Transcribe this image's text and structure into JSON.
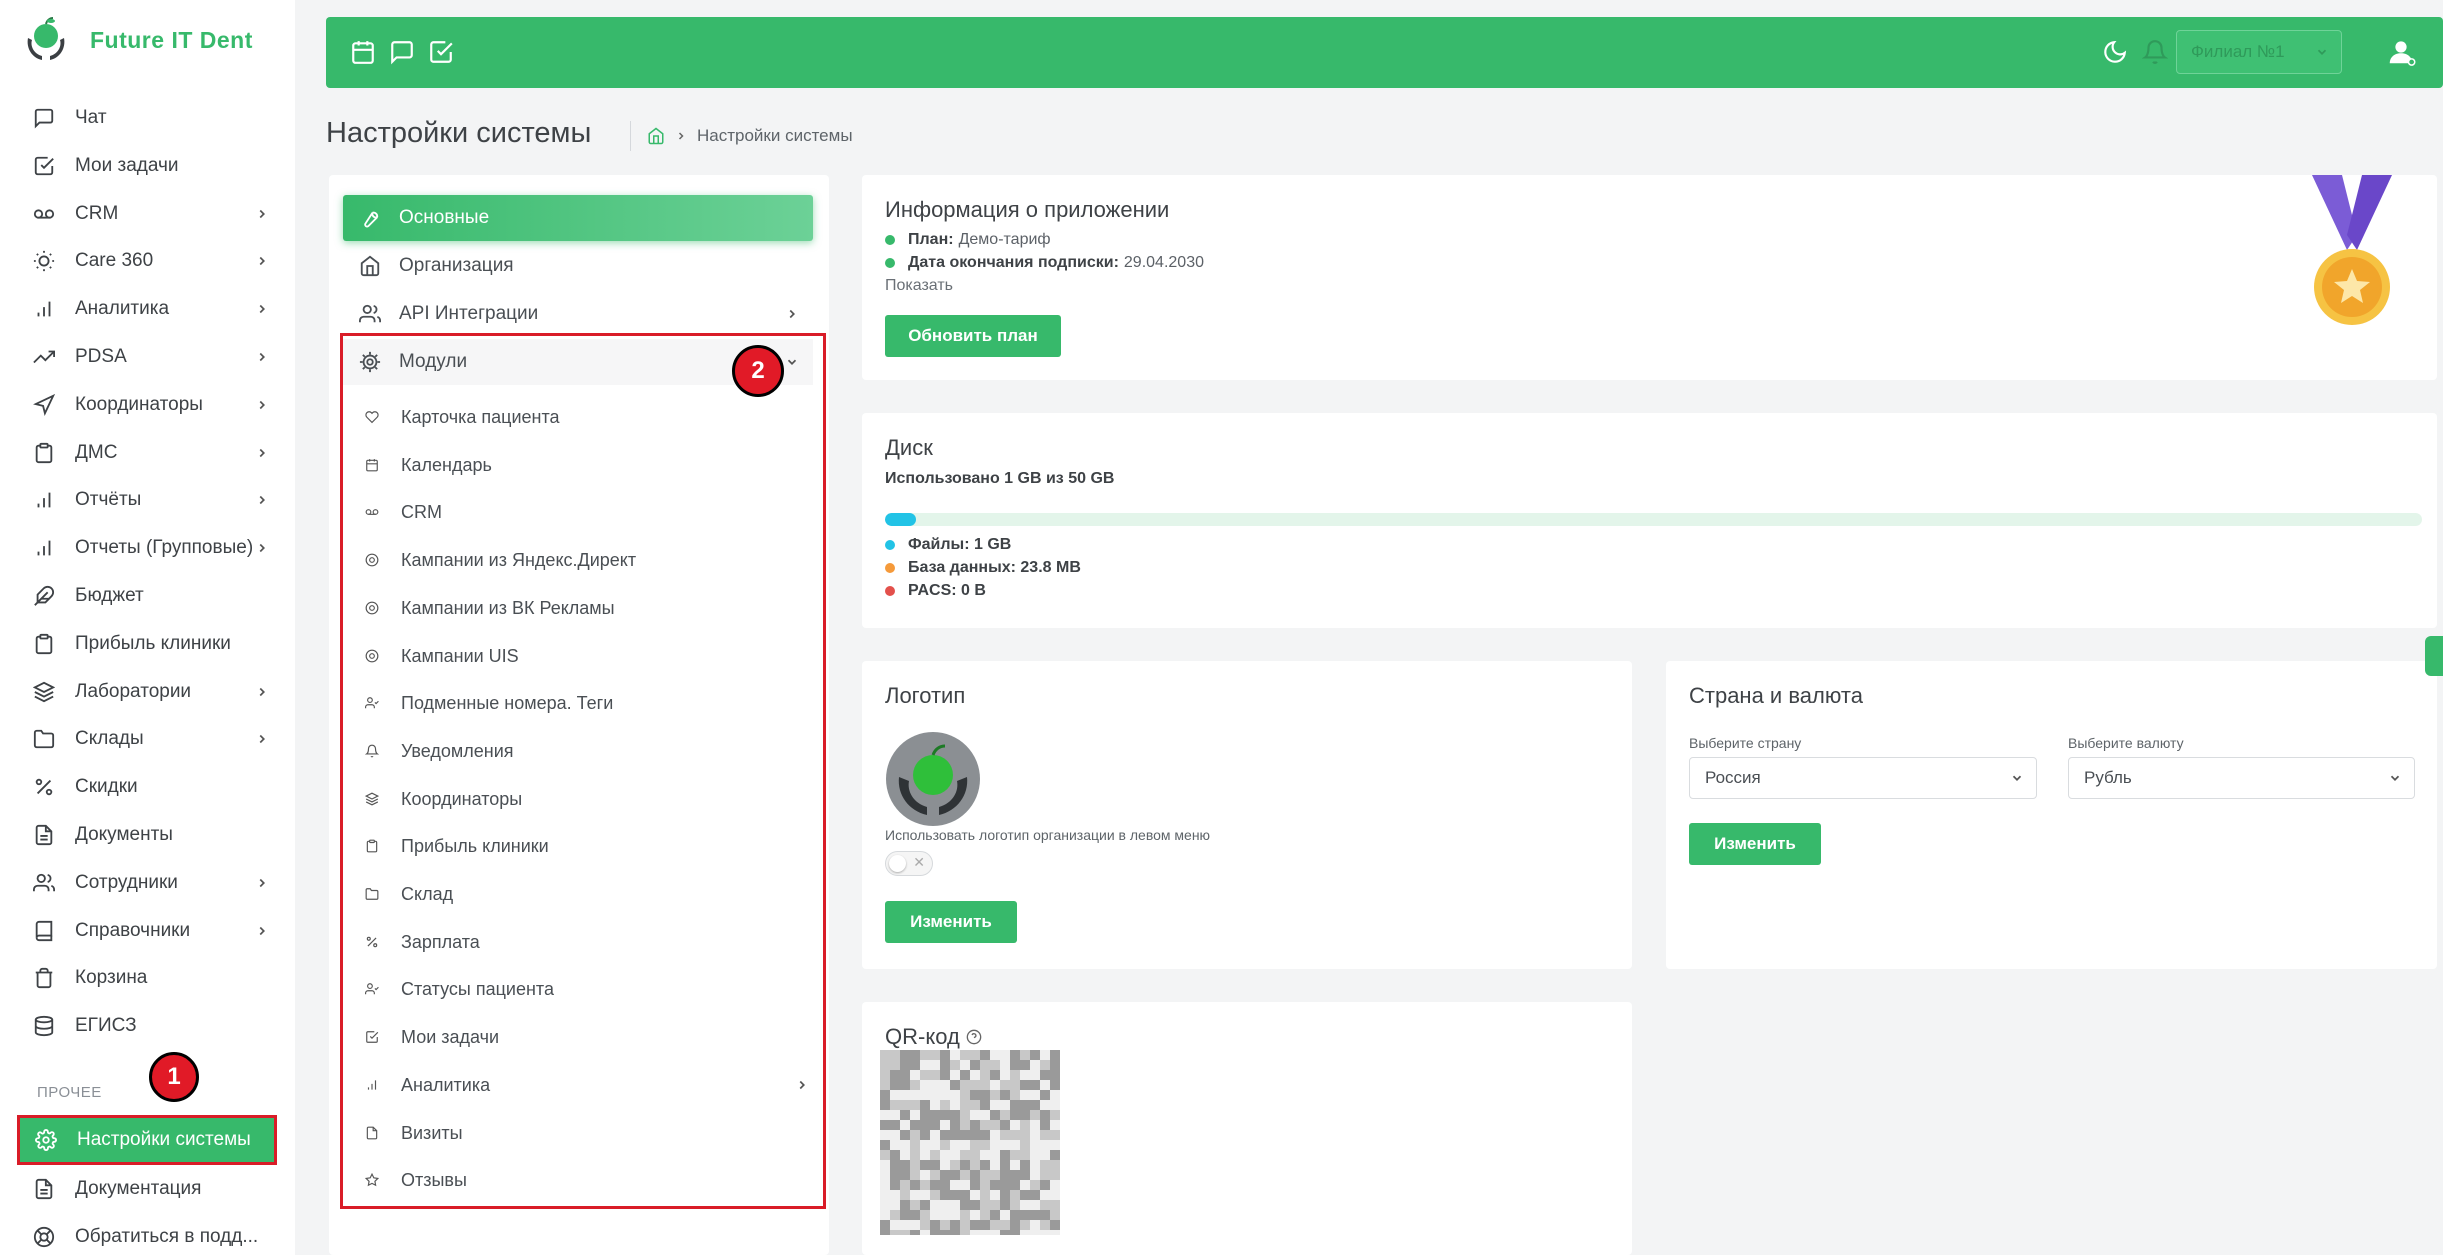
{
  "brand": {
    "name": "Future IT Dent"
  },
  "sidebar": {
    "items": [
      {
        "label": "Чат",
        "icon": "chat-icon",
        "arrow": false
      },
      {
        "label": "Мои задачи",
        "icon": "task-icon",
        "arrow": false
      },
      {
        "label": "CRM",
        "icon": "voicemail-icon",
        "arrow": true
      },
      {
        "label": "Care 360",
        "icon": "sun-icon",
        "arrow": true
      },
      {
        "label": "Аналитика",
        "icon": "bar-chart-icon",
        "arrow": true
      },
      {
        "label": "PDSA",
        "icon": "trending-icon",
        "arrow": true
      },
      {
        "label": "Координаторы",
        "icon": "navigation-icon",
        "arrow": true
      },
      {
        "label": "ДМС",
        "icon": "clipboard-icon",
        "arrow": true
      },
      {
        "label": "Отчёты",
        "icon": "bar-chart-icon",
        "arrow": true
      },
      {
        "label": "Отчеты (Групповые)",
        "icon": "bar-chart-icon",
        "arrow": true
      },
      {
        "label": "Бюджет",
        "icon": "feather-icon",
        "arrow": false
      },
      {
        "label": "Прибыль клиники",
        "icon": "clipboard-icon",
        "arrow": false
      },
      {
        "label": "Лаборатории",
        "icon": "layers-icon",
        "arrow": true
      },
      {
        "label": "Склады",
        "icon": "folder-icon",
        "arrow": true
      },
      {
        "label": "Скидки",
        "icon": "percent-icon",
        "arrow": false
      },
      {
        "label": "Документы",
        "icon": "document-icon",
        "arrow": false
      },
      {
        "label": "Сотрудники",
        "icon": "users-icon",
        "arrow": true
      },
      {
        "label": "Справочники",
        "icon": "book-icon",
        "arrow": true
      },
      {
        "label": "Корзина",
        "icon": "trash-icon",
        "arrow": false
      },
      {
        "label": "ЕГИСЗ",
        "icon": "database-icon",
        "arrow": false
      }
    ],
    "section_label": "ПРОЧЕЕ",
    "active_label": "Настройки системы",
    "bottom_items": [
      {
        "label": "Документация",
        "icon": "document-icon"
      },
      {
        "label": "Обратиться в подд...",
        "icon": "lifebuoy-icon"
      }
    ]
  },
  "markers": {
    "one": "1",
    "two": "2"
  },
  "header": {
    "branch_placeholder": "Филиал №1"
  },
  "page": {
    "title": "Настройки системы",
    "breadcrumb": "Настройки системы"
  },
  "settings_nav": {
    "top": [
      {
        "label": "Основные",
        "icon": "wrench-icon"
      },
      {
        "label": "Организация",
        "icon": "home-icon"
      },
      {
        "label": "API Интеграции",
        "icon": "users-icon"
      },
      {
        "label": "Модули",
        "icon": "gear-icon"
      }
    ],
    "modules": [
      "Карточка пациента",
      "Календарь",
      "CRM",
      "Кампании из Яндекс.Директ",
      "Кампании из ВК Рекламы",
      "Кампании UIS",
      "Подменные номера. Теги",
      "Уведомления",
      "Координаторы",
      "Прибыль клиники",
      "Склад",
      "Зарплата",
      "Статусы пациента",
      "Мои задачи",
      "Аналитика",
      "Визиты",
      "Отзывы"
    ]
  },
  "app_info": {
    "title": "Информация о приложении",
    "plan_label": "План:",
    "plan_value": "Демо-тариф",
    "expiry_label": "Дата окончания подписки:",
    "expiry_value": "29.04.2030",
    "show_link": "Показать",
    "update_button": "Обновить план"
  },
  "disk": {
    "title": "Диск",
    "used_text": "Использовано 1 GB из 50 GB",
    "used_fraction": 0.02,
    "files": "Файлы: 1 GB",
    "database": "База данных: 23.8 MB",
    "pacs": "PACS: 0 B"
  },
  "logo_card": {
    "title": "Логотип",
    "toggle_label": "Использовать логотип организации в левом меню",
    "toggle_on": false,
    "change_button": "Изменить"
  },
  "country_card": {
    "title": "Страна и валюта",
    "country_label": "Выберите страну",
    "country_value": "Россия",
    "currency_label": "Выберите валюту",
    "currency_value": "Рубль",
    "change_button": "Изменить"
  },
  "qr_card": {
    "title": "QR-код"
  },
  "colors": {
    "accent": "#37b96b",
    "marker": "#e11a27",
    "files": "#22c3e6",
    "database": "#f59a3a",
    "pacs": "#e3504b"
  }
}
